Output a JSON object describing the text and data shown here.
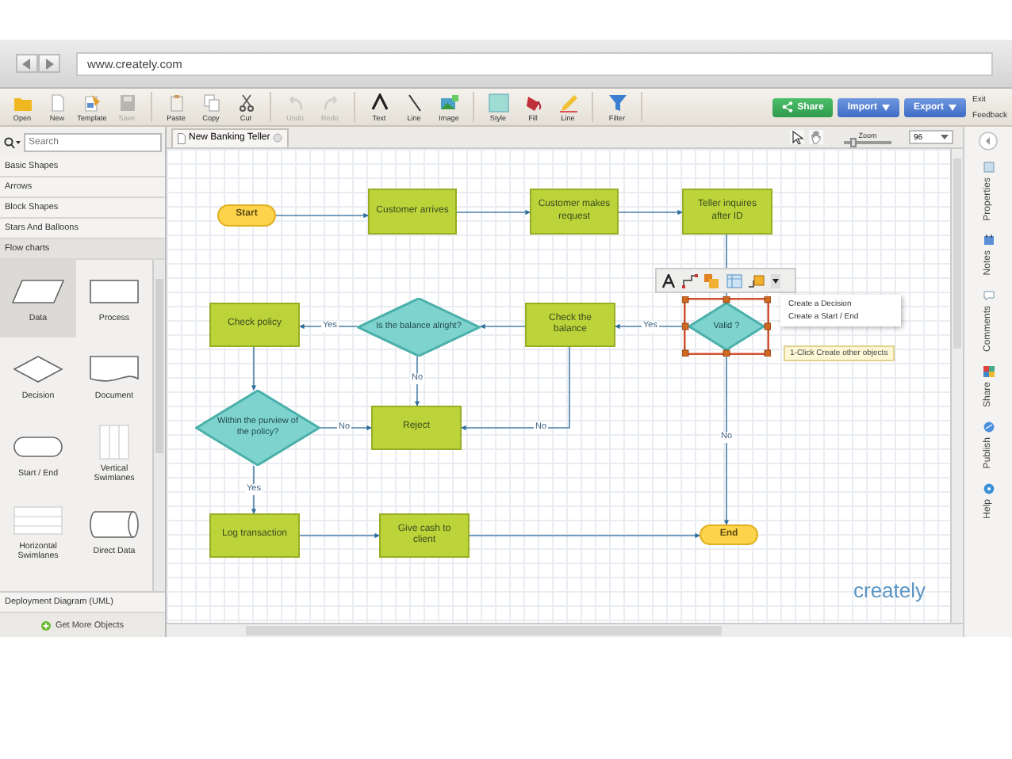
{
  "browser": {
    "url": "www.creately.com"
  },
  "toolbar": {
    "groups": [
      [
        {
          "label": "Open",
          "disabled": false
        },
        {
          "label": "New",
          "disabled": false
        },
        {
          "label": "Template",
          "disabled": false
        },
        {
          "label": "Save",
          "disabled": true
        }
      ],
      [
        {
          "label": "Paste",
          "disabled": false
        },
        {
          "label": "Copy",
          "disabled": false
        },
        {
          "label": "Cut",
          "disabled": false
        }
      ],
      [
        {
          "label": "Undo",
          "disabled": true
        },
        {
          "label": "Redo",
          "disabled": true
        }
      ],
      [
        {
          "label": "Text",
          "disabled": false
        },
        {
          "label": "Line",
          "disabled": false
        },
        {
          "label": "Image",
          "disabled": false
        }
      ],
      [
        {
          "label": "Style",
          "disabled": false
        },
        {
          "label": "Fill",
          "disabled": false
        },
        {
          "label": "Line",
          "disabled": false
        }
      ],
      [
        {
          "label": "Filter",
          "disabled": false
        }
      ]
    ],
    "buttons": [
      {
        "label": "Share",
        "kind": "share"
      },
      {
        "label": "Import",
        "kind": "menu"
      },
      {
        "label": "Export",
        "kind": "menu"
      }
    ],
    "links": [
      "Exit",
      "Feedback"
    ]
  },
  "search": {
    "placeholder": "Search"
  },
  "library": {
    "categories": [
      {
        "label": "Basic Shapes",
        "expanded": false
      },
      {
        "label": "Arrows",
        "expanded": false
      },
      {
        "label": "Block Shapes",
        "expanded": false
      },
      {
        "label": "Stars And Balloons",
        "expanded": false
      },
      {
        "label": "Flow charts",
        "expanded": true
      }
    ],
    "shapes": [
      {
        "label": "Data",
        "selected": true
      },
      {
        "label": "Process",
        "selected": false
      },
      {
        "label": "Decision",
        "selected": false
      },
      {
        "label": "Document",
        "selected": false
      },
      {
        "label": "Start / End",
        "selected": false
      },
      {
        "label": "Vertical Swimlanes",
        "selected": false
      },
      {
        "label": "Horizontal Swimlanes",
        "selected": false
      },
      {
        "label": "Direct Data",
        "selected": false
      }
    ],
    "footer_category": "Deployment Diagram (UML)",
    "more_button": "Get More Objects"
  },
  "document_tab": {
    "title": "New Banking Teller"
  },
  "zoom": {
    "label": "Zoom",
    "level": 0.2,
    "value": "96"
  },
  "diagram": {
    "nodes": [
      {
        "kind": "terminator",
        "text": "Start",
        "selected": false
      },
      {
        "kind": "process",
        "text": "Customer arrives",
        "selected": false
      },
      {
        "kind": "process",
        "text": "Customer makes request",
        "selected": false
      },
      {
        "kind": "process",
        "text": "Teller inquires after ID",
        "selected": false
      },
      {
        "kind": "process",
        "text": "Check policy",
        "selected": false
      },
      {
        "kind": "decision",
        "text": "Is the balance alright?",
        "selected": false
      },
      {
        "kind": "process",
        "text": "Check the balance",
        "selected": false
      },
      {
        "kind": "decision",
        "text": "Valid ?",
        "selected": true
      },
      {
        "kind": "decision",
        "text": "Within the purview of the policy?",
        "selected": false
      },
      {
        "kind": "process",
        "text": "Reject",
        "selected": false
      },
      {
        "kind": "process",
        "text": "Log transaction",
        "selected": false
      },
      {
        "kind": "process",
        "text": "Give cash to client",
        "selected": false
      },
      {
        "kind": "terminator",
        "text": "End",
        "selected": false
      }
    ],
    "connector_labels": [
      "Yes",
      "Yes",
      "No",
      "No",
      "No",
      "No",
      "Yes"
    ],
    "quick_menu": [
      "Create a Decision",
      "Create a Start / End"
    ],
    "tooltip": "1-Click Create other objects",
    "logo": "creately"
  },
  "side_tabs": [
    "Properties",
    "Notes",
    "Comments",
    "Share",
    "Publish",
    "Help"
  ]
}
